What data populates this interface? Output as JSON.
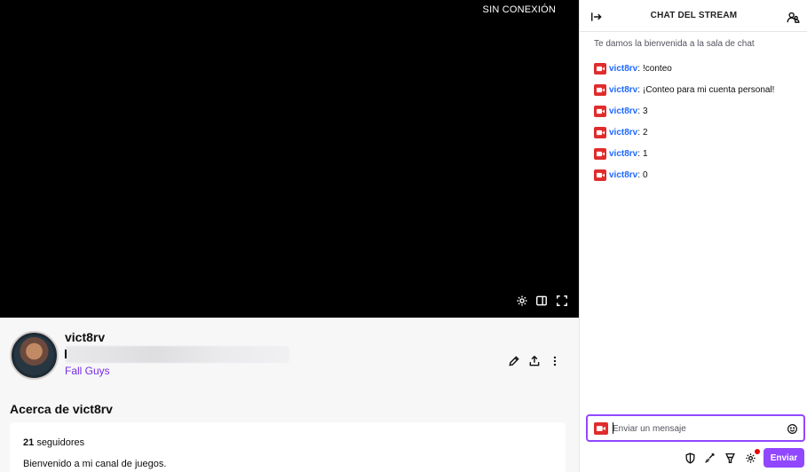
{
  "video": {
    "status": "SIN CONEXIÓN",
    "controls": [
      "settings-icon",
      "theatre-mode-icon",
      "fullscreen-icon"
    ]
  },
  "channel": {
    "name": "vict8rv",
    "game": "Fall Guys",
    "actions": [
      "edit-icon",
      "share-icon",
      "more-icon"
    ]
  },
  "about": {
    "title": "Acerca de vict8rv",
    "followers_count": "21",
    "followers_label": "seguidores",
    "bio": "Bienvenido a mi canal de juegos."
  },
  "chat": {
    "title": "CHAT DEL STREAM",
    "welcome": "Te damos la bienvenida a la sala de chat",
    "messages": [
      {
        "user": "vict8rv",
        "text": "!conteo"
      },
      {
        "user": "vict8rv",
        "text": "¡Conteo para mi cuenta personal!"
      },
      {
        "user": "vict8rv",
        "text": "3"
      },
      {
        "user": "vict8rv",
        "text": "2"
      },
      {
        "user": "vict8rv",
        "text": "1"
      },
      {
        "user": "vict8rv",
        "text": "0"
      }
    ],
    "input_placeholder": "Enviar un mensaje",
    "send_label": "Enviar"
  },
  "colors": {
    "accent": "#9147ff",
    "username": "#1e69ff",
    "broadcaster_badge": "#e02c2c",
    "game_link": "#772ce8"
  }
}
